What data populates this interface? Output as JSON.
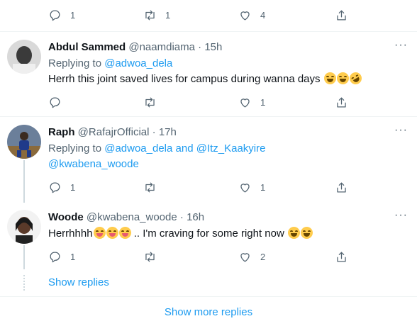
{
  "top_actions": {
    "reply_count": "1",
    "retweet_count": "1",
    "like_count": "4"
  },
  "tweets": [
    {
      "name": "Abdul Sammed",
      "handle": "@naamdiama",
      "dot": "·",
      "time": "15h",
      "replying_prefix": "Replying to ",
      "replying_to": "@adwoa_dela",
      "text": "Herrh this joint saved lives for campus during wanna days",
      "actions": {
        "reply_count": "",
        "retweet_count": "",
        "like_count": "1"
      }
    },
    {
      "name": "Raph",
      "handle": "@RafajrOfficial",
      "dot": "·",
      "time": "17h",
      "replying_prefix": "Replying to ",
      "replying_to": "@adwoa_dela and @Itz_Kaakyire",
      "replying_to_line2": "@kwabena_woode",
      "actions": {
        "reply_count": "1",
        "retweet_count": "",
        "like_count": "1"
      }
    },
    {
      "name": "Woode",
      "handle": "@kwabena_woode",
      "dot": "·",
      "time": "16h",
      "text_start": "Herrhhhh",
      "text_end": " .. I'm craving for some right now ",
      "actions": {
        "reply_count": "1",
        "retweet_count": "",
        "like_count": "2"
      }
    }
  ],
  "show_replies": "Show replies",
  "show_more_replies": "Show more replies",
  "more_menu": "···",
  "colors": {
    "link": "#1d9bf0",
    "secondary": "#536471",
    "divider": "#eff3f4"
  }
}
